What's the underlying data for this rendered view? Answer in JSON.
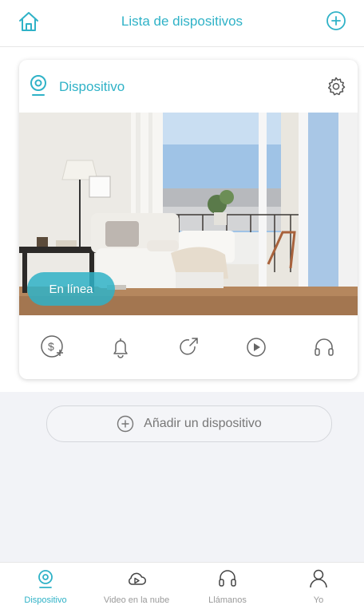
{
  "header": {
    "title": "Lista de dispositivos"
  },
  "device_card": {
    "name": "Dispositivo",
    "status": "En línea"
  },
  "add_device": {
    "label": "Añadir un dispositivo"
  },
  "tabs": [
    {
      "label": "Dispositivo",
      "icon": "camera-icon",
      "active": true
    },
    {
      "label": "Video en la nube",
      "icon": "cloud-play-icon",
      "active": false
    },
    {
      "label": "Llámanos",
      "icon": "headset-icon",
      "active": false
    },
    {
      "label": "Yo",
      "icon": "person-icon",
      "active": false
    }
  ],
  "colors": {
    "accent": "#2fb2c7",
    "background": "#f2f3f7"
  }
}
